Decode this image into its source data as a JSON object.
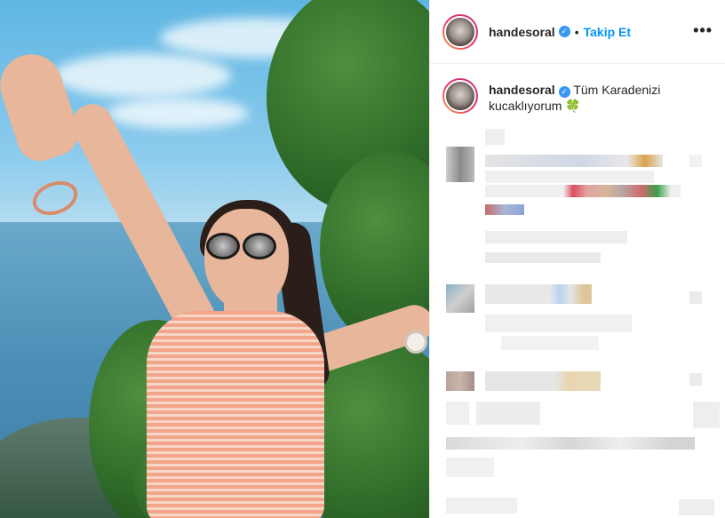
{
  "post": {
    "username": "handesoral",
    "follow_label": "Takip Et",
    "separator": "•",
    "more_label": "•••",
    "verified_glyph": "✓",
    "caption": {
      "username": "handesoral",
      "text": "Tüm Karadenizi kucaklıyorum",
      "emoji": "🍀"
    }
  },
  "colors": {
    "follow_blue": "#0095f6",
    "verified_blue": "#3897f0"
  }
}
